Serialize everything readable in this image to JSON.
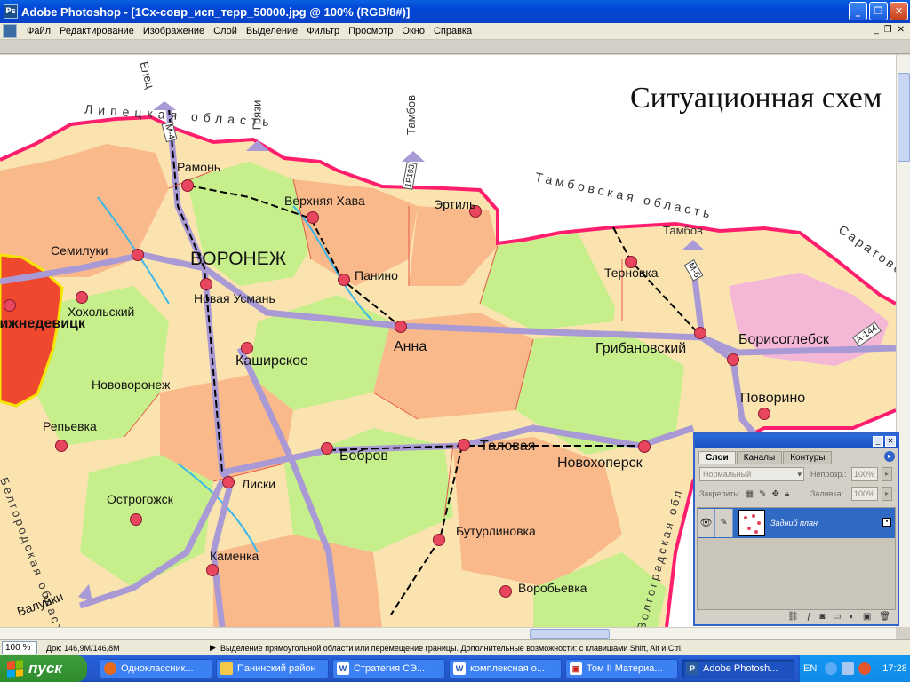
{
  "window": {
    "title": "Adobe Photoshop - [1Сх-совр_исп_терр_50000.jpg @ 100% (RGB/8#)]",
    "app_icon": "Ps"
  },
  "menu": [
    "Файл",
    "Редактирование",
    "Изображение",
    "Слой",
    "Выделение",
    "Фильтр",
    "Просмотр",
    "Окно",
    "Справка"
  ],
  "map": {
    "heading": "Ситуационная схем",
    "regions": [
      "Липецкая область",
      "Тамбовская область",
      "Саратовская",
      "Белгородская область",
      "Волгоградская обл"
    ],
    "directions": [
      "Елец",
      "Грязи",
      "Тамбов",
      "Тамбов",
      "Валуйки"
    ],
    "roads": [
      "М-4",
      "1Р193",
      "М-6",
      "А-144"
    ],
    "capital": "ВОРОНЕЖ",
    "towns": [
      "Рамонь",
      "Верхняя Хава",
      "Эртиль",
      "Семилуки",
      "Хохольский",
      "Нижнедевицк",
      "Новая Усмань",
      "Панино",
      "Терновка",
      "Анна",
      "Каширское",
      "Грибановский",
      "Борисоглебск",
      "Поворино",
      "Нововоронеж",
      "Репьевка",
      "Лиски",
      "Бобров",
      "Таловая",
      "Новохоперск",
      "Острогожск",
      "Бутурлиновка",
      "Каменка",
      "Воробьевка",
      "Валуйки"
    ]
  },
  "layers_panel": {
    "tabs": [
      "Слои",
      "Каналы",
      "Контуры"
    ],
    "blend_mode": "Нормальный",
    "opacity_label": "Непрозр.:",
    "opacity_value": "100%",
    "lock_label": "Закрепить:",
    "fill_label": "Заливка:",
    "fill_value": "100%",
    "layer_name": "Задний план"
  },
  "status": {
    "zoom": "100 %",
    "doc_size": "Док: 146,9M/146,8M",
    "hint": "Выделение прямоугольной области или перемещение границы. Дополнительные возможности: с клавишами Shift, Alt и Ctrl."
  },
  "taskbar": {
    "start": "пуск",
    "tasks": [
      "Одноклассник...",
      "Панинский район",
      "Стратегия СЭ...",
      "комплексная о...",
      "Том II Материа...",
      "Adobe Photosh..."
    ],
    "lang": "EN",
    "clock": "17:28"
  },
  "colors": {
    "titlebar": "#0a5fe0",
    "map_green": "#c6ee8a",
    "map_orange": "#f9b98a",
    "road": "#a99ad6",
    "town": "#e8455e",
    "border": "#ff1e6e"
  }
}
